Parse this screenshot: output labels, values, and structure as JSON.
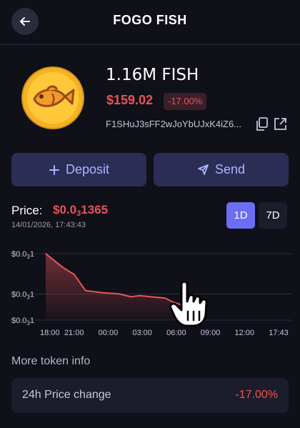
{
  "header": {
    "title": "FOGO FISH"
  },
  "token": {
    "amount": "1.16M FISH",
    "usd_value": "$159.02",
    "change_badge": "-17.00%",
    "address": "F1SHuJ3sFF2wJoYbUJxK4iZ6..."
  },
  "actions": {
    "deposit_label": "Deposit",
    "send_label": "Send"
  },
  "price": {
    "label": "Price:",
    "value_prefix": "$0.0",
    "value_zeros": "3",
    "value_digits": "1365",
    "timestamp": "14/01/2026, 17:43:43"
  },
  "range_buttons": {
    "selected": "1D",
    "options": [
      "1D",
      "7D"
    ]
  },
  "chart_data": {
    "type": "area",
    "x_ticks": [
      "18:00",
      "21:00",
      "00:00",
      "03:00",
      "06:00",
      "09:00",
      "12:00",
      "17:43"
    ],
    "y_ticks": [
      {
        "prefix": "$0.0",
        "zeros": "3",
        "digits": "1"
      },
      {
        "prefix": "$0.0",
        "zeros": "3",
        "digits": "1"
      },
      {
        "prefix": "$0.0",
        "zeros": "3",
        "digits": "1"
      }
    ],
    "x": [
      "18:00",
      "19:30",
      "20:30",
      "21:30",
      "23:00",
      "00:30",
      "01:30",
      "02:15",
      "04:30",
      "05:15",
      "06:15",
      "07:00"
    ],
    "values": [
      1.0,
      0.967,
      0.95,
      0.911,
      0.906,
      0.903,
      0.896,
      0.899,
      0.893,
      0.883,
      0.874,
      0.869
    ],
    "color": "#e8545a",
    "grid": true
  },
  "more_info": {
    "heading": "More token info",
    "rows": [
      {
        "label": "24h Price change",
        "value": "-17.00%"
      }
    ]
  },
  "colors": {
    "background": "#0f1018",
    "negative": "#e8545a",
    "accent": "#6a6ef2",
    "button_bg": "#2b2d55",
    "button_text": "#aab4ff"
  },
  "icons": [
    "arrow-left-icon",
    "plus-icon",
    "send-icon",
    "copy-icon",
    "external-link-icon",
    "pointer-hand-icon"
  ]
}
